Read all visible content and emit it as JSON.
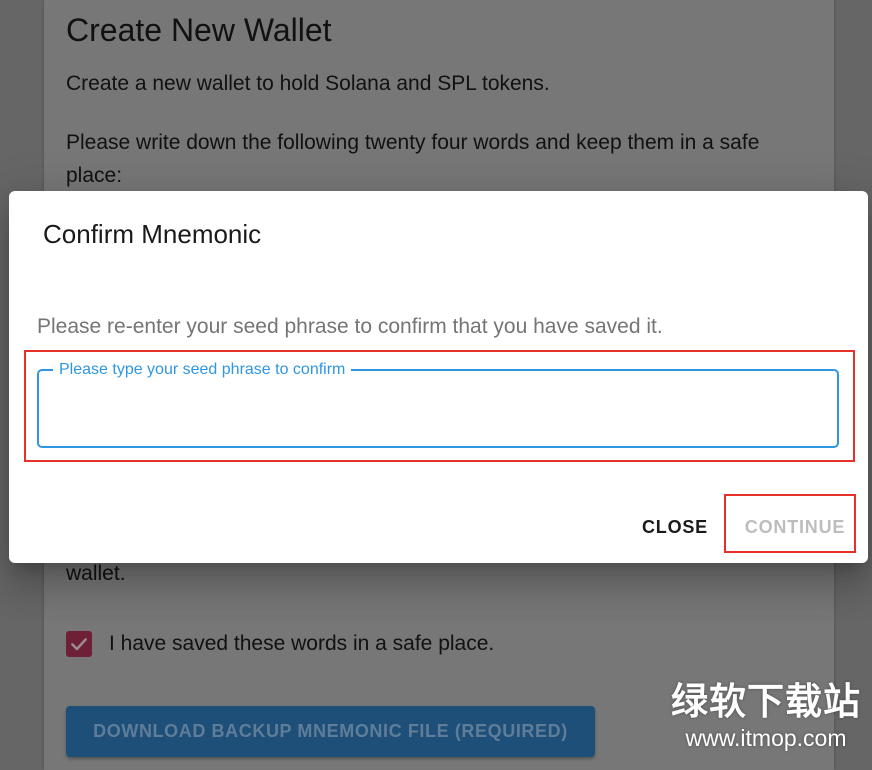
{
  "background": {
    "title": "Create New Wallet",
    "subtitle": "Create a new wallet to hold Solana and SPL tokens.",
    "instructions": "Please write down the following twenty four words and keep them in a safe place:",
    "fragment": "wallet.",
    "checkbox_label": "I have saved these words in a safe place.",
    "checkbox_checked": true,
    "download_button_label": "Download Backup Mnemonic File (Required)"
  },
  "dialog": {
    "title": "Confirm Mnemonic",
    "text": "Please re-enter your seed phrase to confirm that you have saved it.",
    "input": {
      "label": "Please type your seed phrase to confirm",
      "value": ""
    },
    "close_label": "Close",
    "continue_label": "Continue"
  },
  "watermark": {
    "main": "绿软下载站",
    "url": "www.itmop.com"
  },
  "colors": {
    "accent": "#2f97e2",
    "highlight": "#e8302a",
    "checkbox": "#6e2136",
    "disabled_text": "#bdbdbd"
  }
}
